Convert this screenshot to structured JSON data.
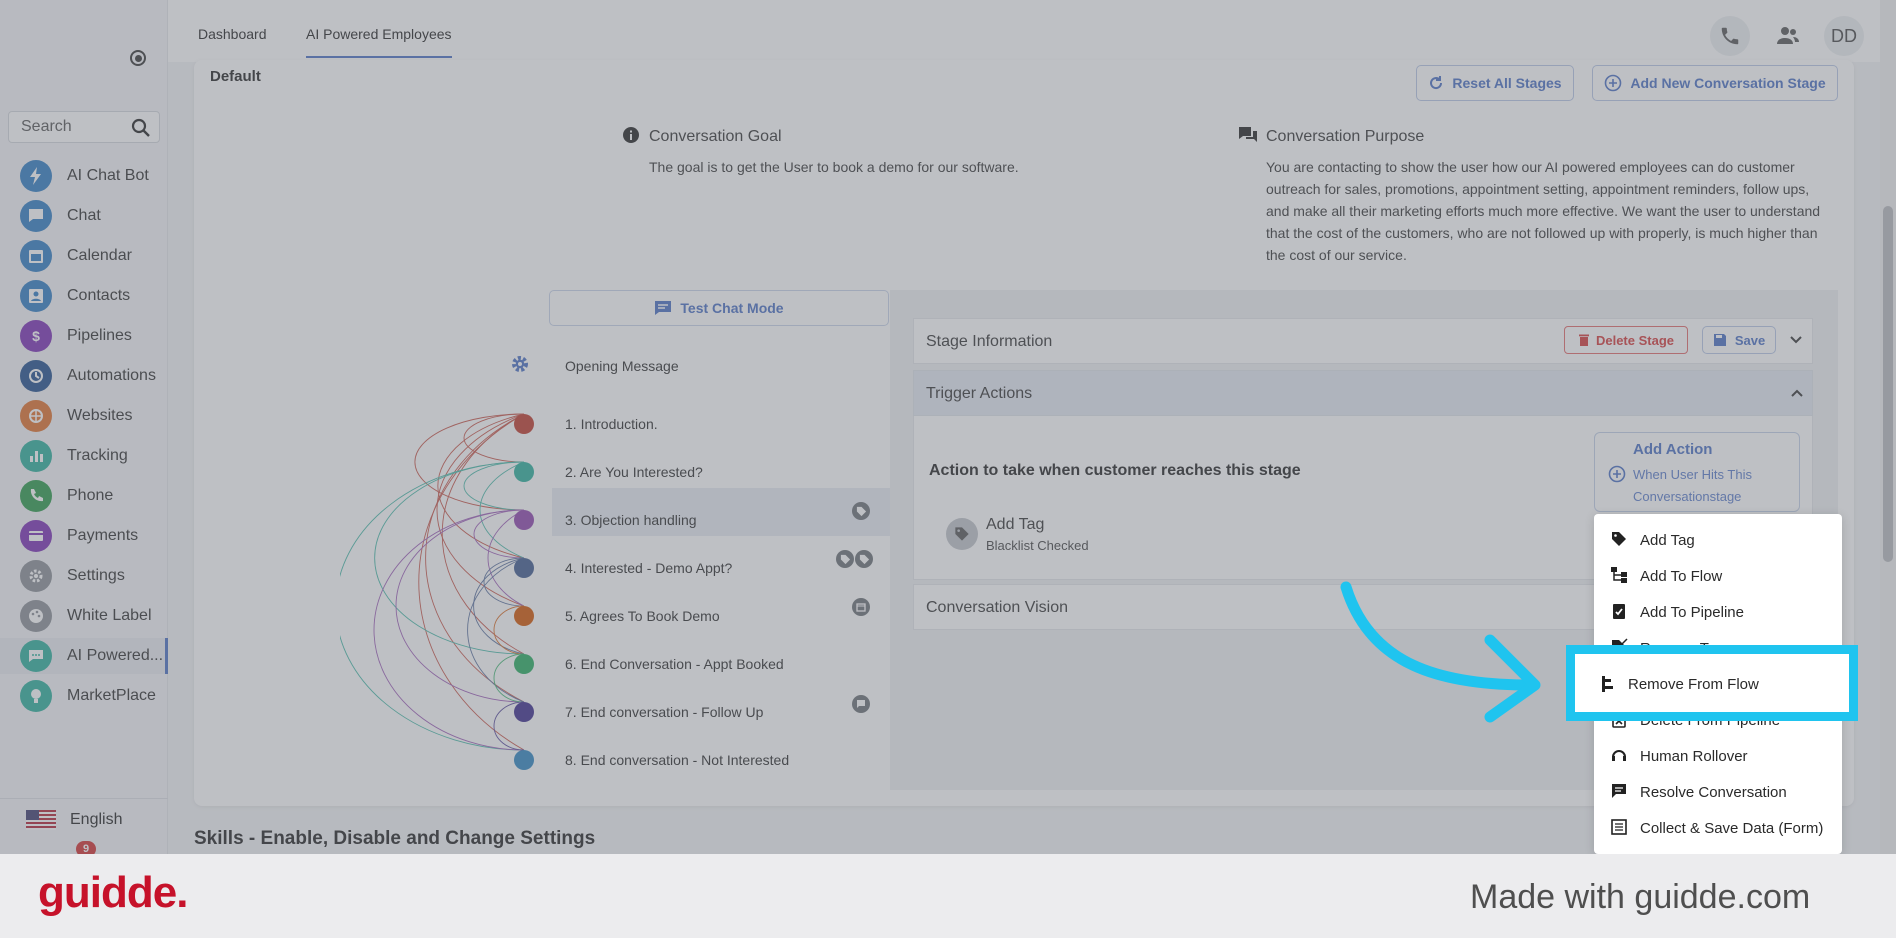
{
  "topbar": {
    "tabs": [
      "Dashboard",
      "AI Powered Employees"
    ],
    "avatar_initials": "DD"
  },
  "sidebar": {
    "search_placeholder": "Search",
    "items": [
      {
        "label": "AI Chat Bot",
        "icon": "bolt-icon",
        "color": "#2e7cc4"
      },
      {
        "label": "Chat",
        "icon": "chat-icon",
        "color": "#2e7cc4"
      },
      {
        "label": "Calendar",
        "icon": "calendar-icon",
        "color": "#2e7cc4"
      },
      {
        "label": "Contacts",
        "icon": "contacts-icon",
        "color": "#2e7cc4"
      },
      {
        "label": "Pipelines",
        "icon": "dollar-icon",
        "color": "#7b2fb5"
      },
      {
        "label": "Automations",
        "icon": "automation-icon",
        "color": "#1f4e8c"
      },
      {
        "label": "Websites",
        "icon": "websites-icon",
        "color": "#e0702a"
      },
      {
        "label": "Tracking",
        "icon": "chart-icon",
        "color": "#2bb09b"
      },
      {
        "label": "Phone",
        "icon": "phone-icon",
        "color": "#2b9a4a"
      },
      {
        "label": "Payments",
        "icon": "card-icon",
        "color": "#7b2fb5"
      },
      {
        "label": "Settings",
        "icon": "gear-icon",
        "color": "#8a8f96"
      },
      {
        "label": "White Label",
        "icon": "palette-icon",
        "color": "#8a8f96"
      },
      {
        "label": "AI Powered...",
        "icon": "ai-chat-icon",
        "color": "#2bb09b"
      },
      {
        "label": "MarketPlace",
        "icon": "bulb-icon",
        "color": "#2bb09b"
      }
    ],
    "language": "English",
    "notification_count": "9"
  },
  "card": {
    "title": "Default",
    "reset_label": "Reset All Stages",
    "add_stage_label": "Add New Conversation Stage",
    "goal_title": "Conversation Goal",
    "goal_text": "The goal is to get the User to book a demo for our software.",
    "purpose_title": "Conversation Purpose",
    "purpose_text": "You are contacting to show the user how our AI powered employees can do customer outreach for sales, promotions, appointment setting, appointment reminders, follow ups, and make all their marketing efforts much more effective. We want the user to understand that the cost of the customers, who are not followed up with properly, is much higher than the cost of our service.",
    "test_chat_label": "Test Chat Mode",
    "opening_message": "Opening Message"
  },
  "stages": [
    {
      "label": "1. Introduction.",
      "color": "#c0392b"
    },
    {
      "label": "2. Are You Interested?",
      "color": "#2bb09b"
    },
    {
      "label": "3. Objection handling",
      "color": "#8e44ad"
    },
    {
      "label": "4. Interested - Demo Appt?",
      "color": "#3f5a8f"
    },
    {
      "label": "5. Agrees To Book Demo",
      "color": "#d35400"
    },
    {
      "label": "6. End Conversation - Appt Booked",
      "color": "#27ae60"
    },
    {
      "label": "7. End conversation - Follow Up",
      "color": "#3b2b8c"
    },
    {
      "label": "8. End conversation - Not Interested",
      "color": "#2e86c1"
    }
  ],
  "panel": {
    "stage_info": "Stage Information",
    "delete_stage": "Delete Stage",
    "save": "Save",
    "trigger_actions": "Trigger Actions",
    "action_text": "Action to take when customer reaches this stage",
    "add_action_title": "Add Action",
    "add_action_sub": "When User Hits This Conversationstage",
    "tag_title": "Add Tag",
    "tag_sub": "Blacklist Checked",
    "vision": "Conversation Vision"
  },
  "dropdown": {
    "items": [
      {
        "label": "Add Tag",
        "icon": "tag-icon"
      },
      {
        "label": "Add To Flow",
        "icon": "flow-icon"
      },
      {
        "label": "Add To Pipeline",
        "icon": "clipboard-check-icon"
      },
      {
        "label": "Remove Tag",
        "icon": "tag-off-icon"
      },
      {
        "label": "Remove From Flow",
        "icon": "flow-remove-icon"
      },
      {
        "label": "Delete From Pipeline",
        "icon": "clipboard-delete-icon"
      },
      {
        "label": "Human Rollover",
        "icon": "headset-icon"
      },
      {
        "label": "Resolve Conversation",
        "icon": "message-icon"
      },
      {
        "label": "Collect & Save Data (Form)",
        "icon": "form-icon"
      }
    ]
  },
  "skills_heading": "Skills - Enable, Disable and Change Settings",
  "footer": {
    "logo": "guidde.",
    "made_with": "Made with guidde.com"
  },
  "colors": {
    "accent": "#4a6fc4",
    "highlight": "#1fc4ef",
    "logo": "#c6122a"
  }
}
